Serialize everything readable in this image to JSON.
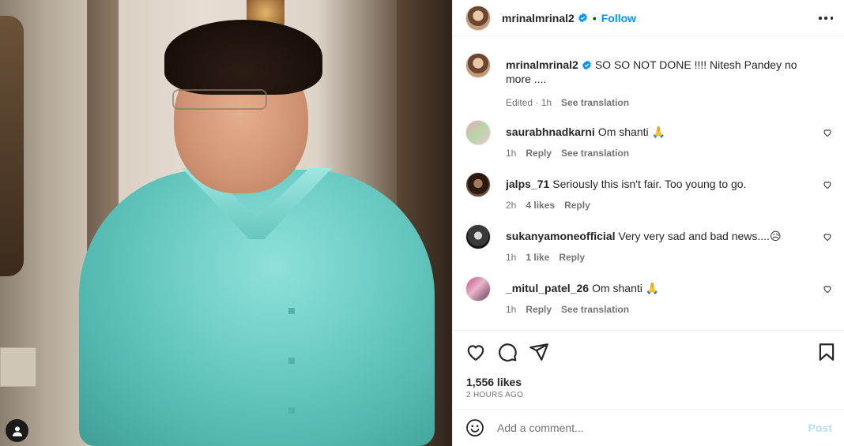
{
  "post": {
    "author": "mrinalmrinal2",
    "follow_label": "Follow",
    "dot": "•",
    "caption_text": "SO SO NOT DONE !!!! Nitesh Pandey no more ....",
    "caption_meta_edited": "Edited · 1h",
    "see_translation": "See translation"
  },
  "comments": [
    {
      "user": "saurabhnadkarni",
      "text": "Om shanti 🙏",
      "time": "1h",
      "likes": "",
      "reply": "Reply",
      "translate": "See translation"
    },
    {
      "user": "jalps_71",
      "text": "Seriously this isn't fair. Too young to go.",
      "time": "2h",
      "likes": "4 likes",
      "reply": "Reply",
      "translate": ""
    },
    {
      "user": "sukanyamoneofficial",
      "text": "Very very sad and bad news....😥",
      "time": "1h",
      "likes": "1 like",
      "reply": "Reply",
      "translate": ""
    },
    {
      "user": "_mitul_patel_26",
      "text": "Om shanti 🙏",
      "time": "1h",
      "likes": "",
      "reply": "Reply",
      "translate": "See translation"
    }
  ],
  "footer": {
    "likes": "1,556 likes",
    "timestamp": "2 HOURS AGO",
    "comment_placeholder": "Add a comment...",
    "post_label": "Post"
  },
  "colors": {
    "accent": "#0095f6",
    "post_disabled": "#b2dffc",
    "text": "#262626",
    "muted": "#737373"
  },
  "icons": [
    "verified-badge-icon",
    "more-options-icon",
    "heart-icon",
    "comment-icon",
    "share-icon",
    "save-icon",
    "emoji-icon",
    "tagged-user-icon"
  ]
}
